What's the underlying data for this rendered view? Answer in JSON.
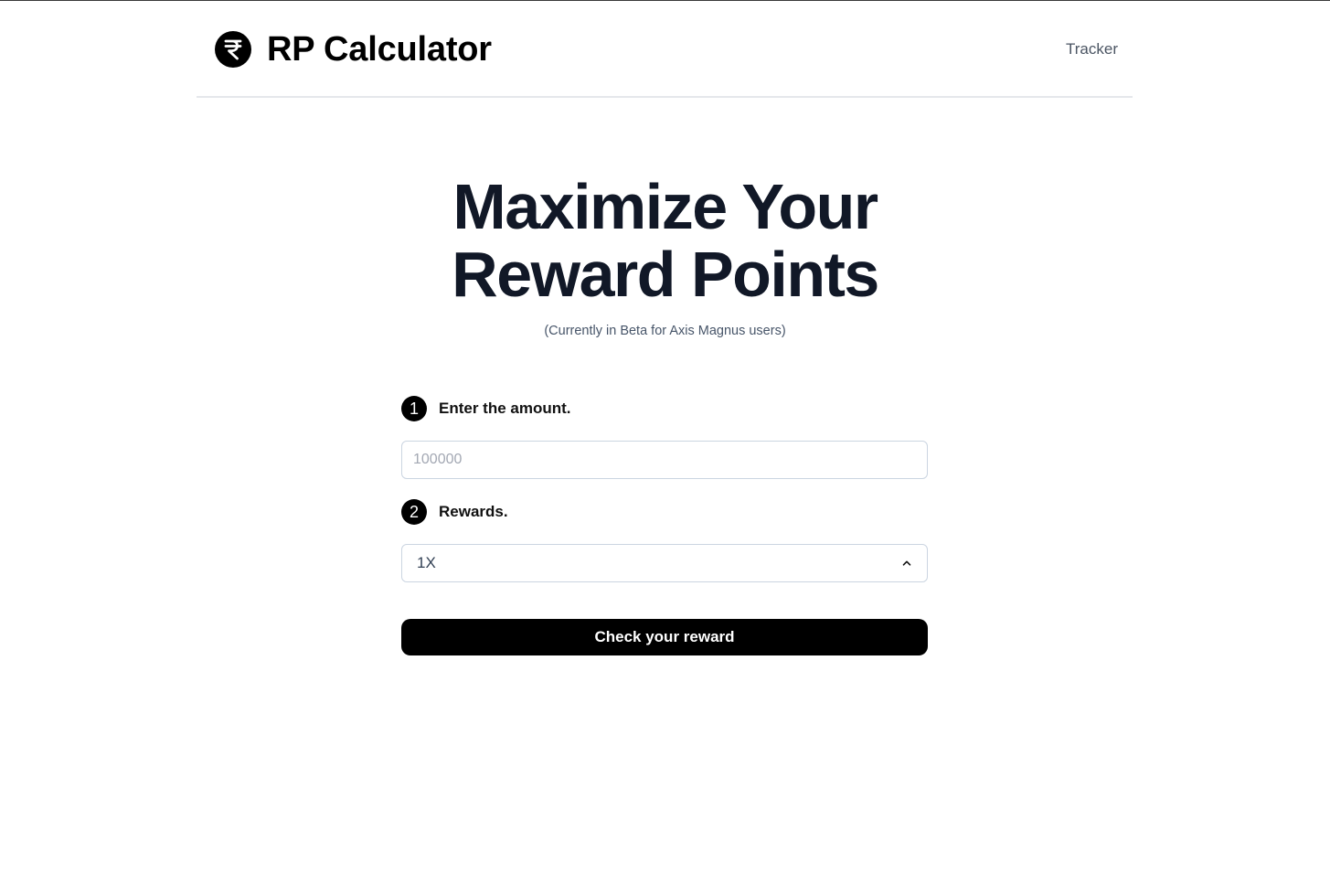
{
  "header": {
    "logo_icon": "rupee-coin-icon",
    "app_title": "RP Calculator",
    "nav_tracker_label": "Tracker"
  },
  "hero": {
    "title_line1": "Maximize Your",
    "title_line2": "Reward Points",
    "subtitle": "(Currently in Beta for Axis Magnus users)"
  },
  "form": {
    "step1": {
      "number": "1",
      "label": "Enter the amount."
    },
    "amount_input": {
      "value": "",
      "placeholder": "100000"
    },
    "step2": {
      "number": "2",
      "label": "Rewards."
    },
    "rewards_select": {
      "selected": "1X",
      "icon": "chevron-up-icon"
    },
    "submit_label": "Check your reward"
  },
  "colors": {
    "primary": "#000000",
    "heading": "#111827",
    "muted": "#475569",
    "border": "#cbd5e1"
  }
}
